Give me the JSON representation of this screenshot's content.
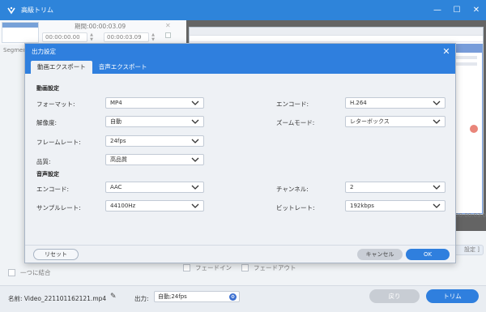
{
  "app": {
    "title": "高級トリム",
    "window_controls": [
      "—",
      "☐",
      "✕"
    ]
  },
  "segment": {
    "period_label": "期間:",
    "period_value": "00:00:03.09",
    "start_time": "00:00:00.00",
    "end_time": "00:00:03.09",
    "label": "Segment"
  },
  "background": {
    "time_right": "00:00:03.09",
    "settings_button": "設定 ]",
    "merge_label": "一つに結合",
    "fade_in_label": "フェードイン",
    "fade_out_label": "フェードアウト"
  },
  "bottom": {
    "name_label": "名前: Video_221101162121.mp4",
    "output_label": "出力:",
    "output_value": "自動;24fps",
    "back_button": "戻り",
    "trim_button": "トリム"
  },
  "dialog": {
    "title": "出力設定",
    "tabs": [
      {
        "label": "動画エクスポート",
        "active": true
      },
      {
        "label": "音声エクスポート",
        "active": false
      }
    ],
    "video_section": "動画設定",
    "audio_section": "音声設定",
    "video": {
      "format": {
        "label": "フォーマット:",
        "value": "MP4"
      },
      "encode": {
        "label": "エンコード:",
        "value": "H.264"
      },
      "resolution": {
        "label": "解像度:",
        "value": "自動"
      },
      "zoom_mode": {
        "label": "ズームモード:",
        "value": "レターボックス"
      },
      "frame_rate": {
        "label": "フレームレート:",
        "value": "24fps"
      },
      "quality": {
        "label": "品質:",
        "value": "高品質"
      }
    },
    "audio": {
      "encode": {
        "label": "エンコード:",
        "value": "AAC"
      },
      "channel": {
        "label": "チャンネル:",
        "value": "2"
      },
      "sample_rate": {
        "label": "サンプルレート:",
        "value": "44100Hz"
      },
      "bitrate": {
        "label": "ビットレート:",
        "value": "192kbps"
      }
    },
    "reset_button": "リセット",
    "cancel_button": "キャンセル",
    "ok_button": "OK"
  },
  "colors": {
    "accent": "#2f7fde",
    "dialog_bg": "#eef1f5"
  }
}
